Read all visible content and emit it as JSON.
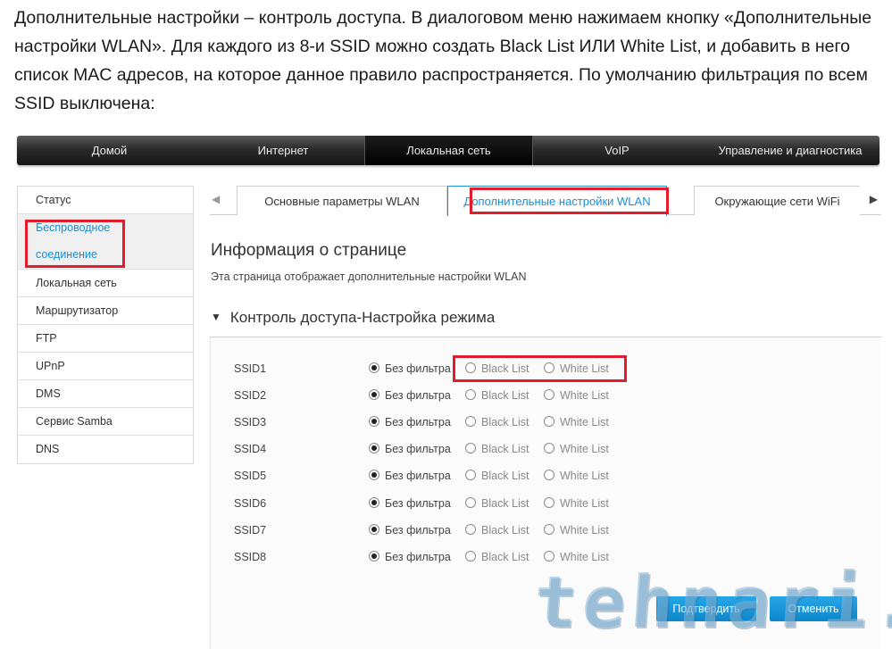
{
  "intro": {
    "text": "Дополнительные настройки – контроль доступа. В диалоговом меню нажимаем кнопку «Дополнительные настройки WLAN». Для каждого из 8-и SSID можно создать Black List ИЛИ White List, и добавить в него список MAC адресов, на которое данное правило распространяется. По умолчанию фильтрация по всем SSID выключена:"
  },
  "topnav": {
    "items": [
      {
        "label": "Домой"
      },
      {
        "label": "Интернет"
      },
      {
        "label": "Локальная сеть"
      },
      {
        "label": "VoIP"
      },
      {
        "label": "Управление и диагностика"
      }
    ],
    "active_index": 2
  },
  "sidebar": {
    "items": [
      {
        "label": "Статус"
      },
      {
        "label": "Беспроводное соединение"
      },
      {
        "label": "Локальная сеть"
      },
      {
        "label": "Маршрутизатор"
      },
      {
        "label": "FTP"
      },
      {
        "label": "UPnP"
      },
      {
        "label": "DMS"
      },
      {
        "label": "Сервис Samba"
      },
      {
        "label": "DNS"
      }
    ],
    "active_index": 1
  },
  "tabs": {
    "items": [
      {
        "label": "Основные параметры WLAN"
      },
      {
        "label": "Дополнительные настройки WLAN"
      },
      {
        "label": "Окружающие сети WiFi"
      }
    ],
    "active_index": 1,
    "left_arrow": "◀",
    "right_arrow": "▶"
  },
  "page": {
    "heading": "Информация о странице",
    "description": "Эта страница отображает дополнительные настройки WLAN"
  },
  "section": {
    "toggle": "▼",
    "title": "Контроль доступа-Настройка режима"
  },
  "options": {
    "no_filter": "Без фильтра",
    "black_list": "Black List",
    "white_list": "White List"
  },
  "ssids": [
    {
      "label": "SSID1",
      "selected": "no_filter"
    },
    {
      "label": "SSID2",
      "selected": "no_filter"
    },
    {
      "label": "SSID3",
      "selected": "no_filter"
    },
    {
      "label": "SSID4",
      "selected": "no_filter"
    },
    {
      "label": "SSID5",
      "selected": "no_filter"
    },
    {
      "label": "SSID6",
      "selected": "no_filter"
    },
    {
      "label": "SSID7",
      "selected": "no_filter"
    },
    {
      "label": "SSID8",
      "selected": "no_filter"
    }
  ],
  "buttons": {
    "apply": "Подтвердить",
    "cancel": "Отменить"
  },
  "watermark": "tehnari.ru",
  "colors": {
    "accent": "#1a8fd6",
    "highlight": "#e21c2b",
    "button": "#1797dc"
  }
}
